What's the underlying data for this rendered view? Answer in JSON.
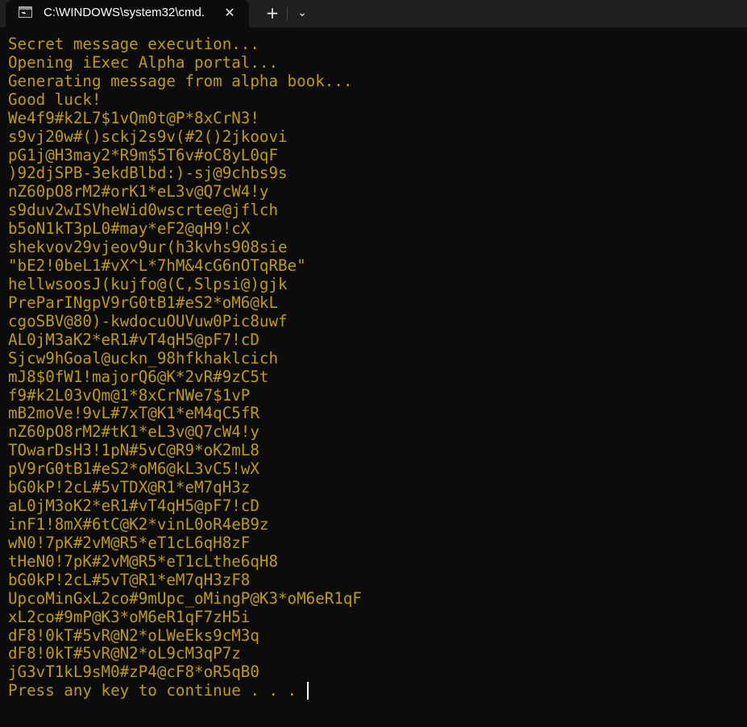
{
  "tab": {
    "title": "C:\\WINDOWS\\system32\\cmd.",
    "close_glyph": "✕",
    "new_tab_glyph": "+",
    "dropdown_glyph": "⌄"
  },
  "colors": {
    "terminal_bg": "#0c0c0c",
    "terminal_text": "#c19c00",
    "titlebar_bg": "#1f1f1f"
  },
  "terminal": {
    "lines": [
      "Secret message execution...",
      "Opening iExec Alpha portal...",
      "Generating message from alpha book...",
      "Good luck!",
      "We4f9#k2L7$1vQm0t@P*8xCrN3!",
      "s9vj20w#()sckj2s9v(#2()2jkoovi",
      "pG1j@H3may2*R9m$5T6v#oC8yL0qF",
      ")92djSPB-3ekdBlbd:)-sj@9chbs9s",
      "nZ60pO8rM2#orK1*eL3v@Q7cW4!y",
      "s9duv2wISVheWid0wscrtee@jflch",
      "b5oN1kT3pL0#may*eF2@qH9!cX",
      "shekvov29vjeov9ur(h3kvhs908sie",
      "\"bE2!0beL1#vX^L*7hM&4cG6nOTqRBe\"",
      "hellwsoosJ(kujfo@(C,Slpsi@)gjk",
      "PreParINgpV9rG0tB1#eS2*oM6@kL",
      "cgoSBV@80)-kwdocuOUVuw0Pic8uwf",
      "AL0jM3aK2*eR1#vT4qH5@pF7!cD",
      "Sjcw9hGoal@uckn_98hfkhaklcich",
      "mJ8$0fW1!majorQ6@K*2vR#9zC5t",
      "f9#k2L03vQm@1*8xCrNWe7$1vP",
      "mB2moVe!9vL#7xT@K1*eM4qC5fR",
      "nZ60pO8rM2#tK1*eL3v@Q7cW4!y",
      "TOwarDsH3!1pN#5vC@R9*oK2mL8",
      "pV9rG0tB1#eS2*oM6@kL3vC5!wX",
      "bG0kP!2cL#5vTDX@R1*eM7qH3z",
      "aL0jM3oK2*eR1#vT4qH5@pF7!cD",
      "inF1!8mX#6tC@K2*vinL0oR4eB9z",
      "wN0!7pK#2vM@R5*eT1cL6qH8zF",
      "tHeN0!7pK#2vM@R5*eT1cLthe6qH8",
      "bG0kP!2cL#5vT@R1*eM7qH3zF8",
      "UpcoMinGxL2co#9mUpc_oMingP@K3*oM6eR1qF",
      "xL2co#9mP@K3*oM6eR1qF7zH5i",
      "dF8!0kT#5vR@N2*oLWeEks9cM3q",
      "dF8!0kT#5vR@N2*oL9cM3qP7z",
      "jG3vT1kL9sM0#zP4@cF8*oR5qB0",
      "Press any key to continue . . . "
    ]
  }
}
